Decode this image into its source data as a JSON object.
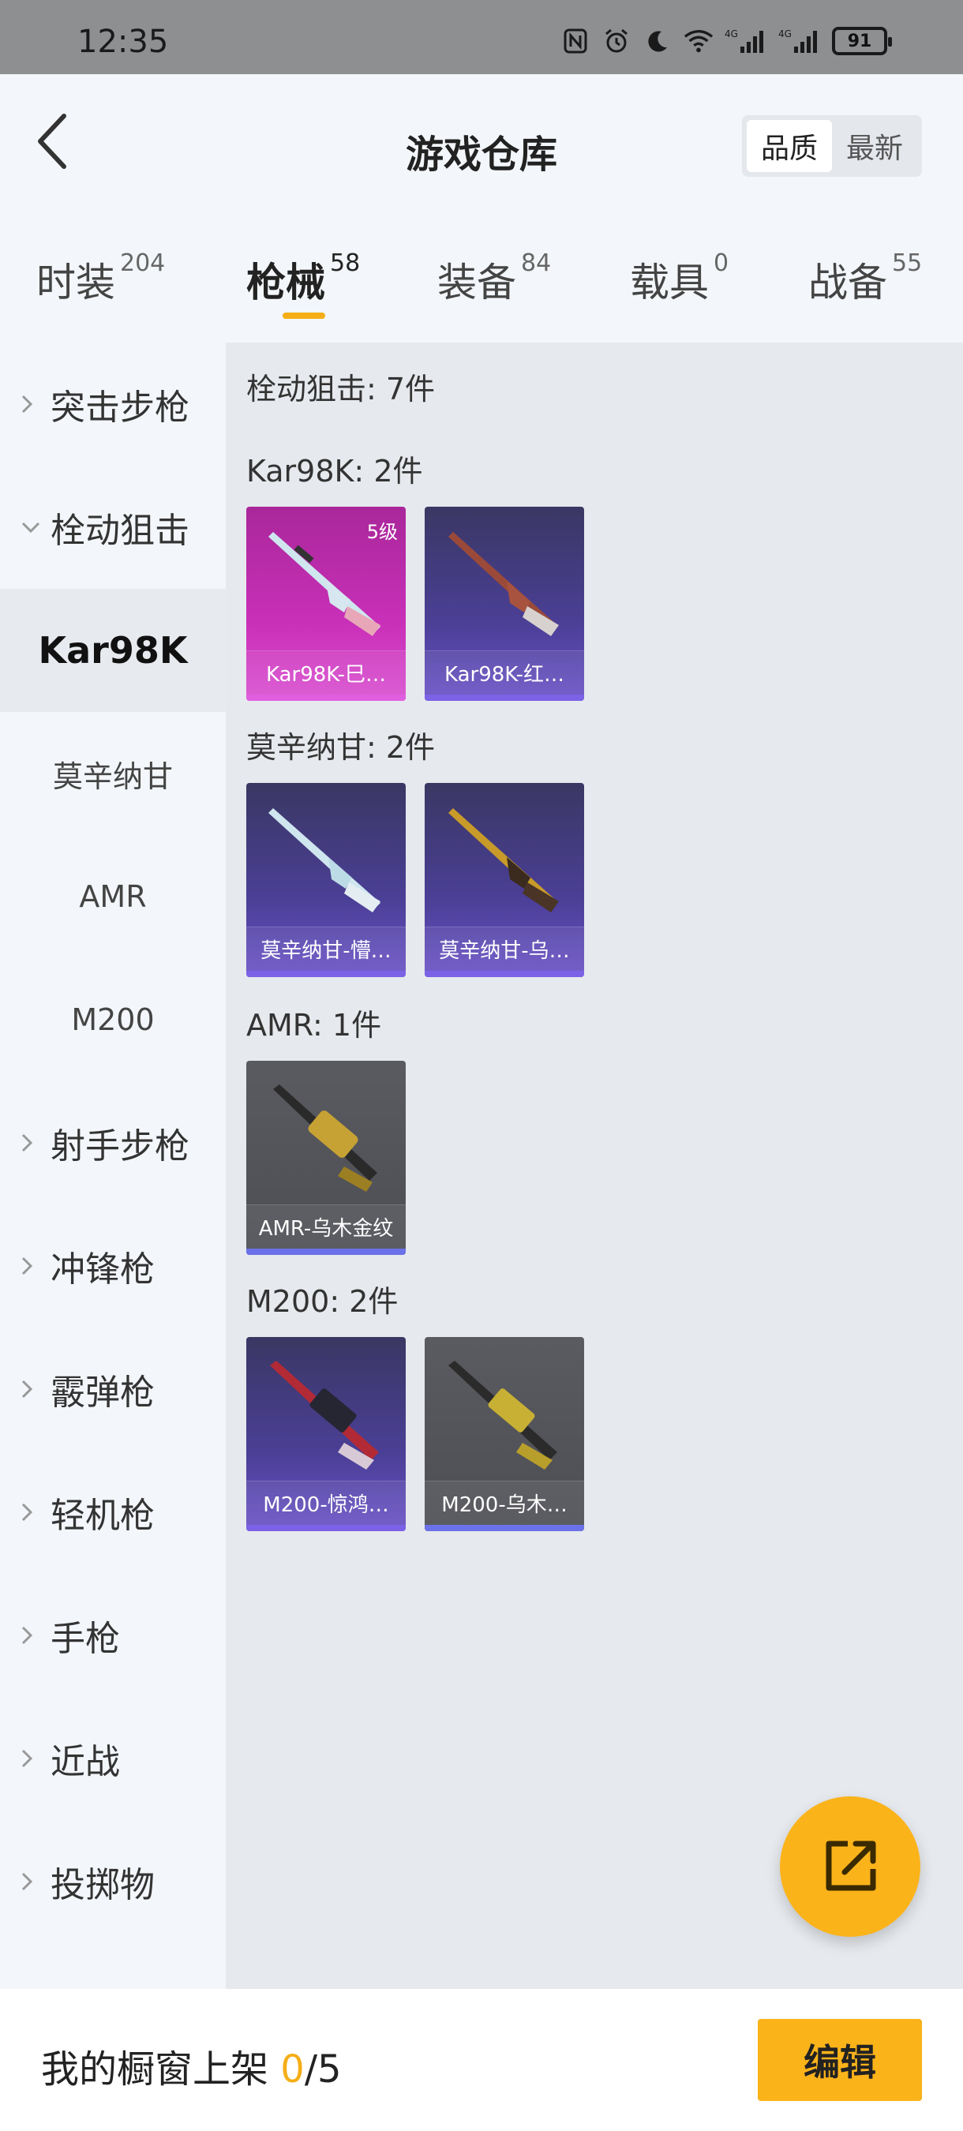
{
  "status_bar": {
    "time": "12:35",
    "battery": "91",
    "net1": "4G",
    "net2": "4G"
  },
  "header": {
    "title": "游戏仓库",
    "sort_options": [
      "品质",
      "最新"
    ],
    "sort_active": "品质"
  },
  "tabs": [
    {
      "label": "时装",
      "count": "204"
    },
    {
      "label": "枪械",
      "count": "58"
    },
    {
      "label": "装备",
      "count": "84"
    },
    {
      "label": "载具",
      "count": "0"
    },
    {
      "label": "战备",
      "count": "55"
    }
  ],
  "sidebar": {
    "items": [
      {
        "label": "突击步枪",
        "expanded": false
      },
      {
        "label": "栓动狙击",
        "expanded": true
      },
      {
        "label": "射手步枪",
        "expanded": false
      },
      {
        "label": "冲锋枪",
        "expanded": false
      },
      {
        "label": "霰弹枪",
        "expanded": false
      },
      {
        "label": "轻机枪",
        "expanded": false
      },
      {
        "label": "手枪",
        "expanded": false
      },
      {
        "label": "近战",
        "expanded": false
      },
      {
        "label": "投掷物",
        "expanded": false
      }
    ],
    "sub_items": [
      "Kar98K",
      "莫辛纳甘",
      "AMR",
      "M200"
    ],
    "active_sub": "Kar98K"
  },
  "content": {
    "summary": "栓动狙击: 7件",
    "groups": [
      {
        "title": "Kar98K: 2件",
        "cards": [
          {
            "name": "Kar98K-巳…",
            "level": "5级",
            "style": "pink"
          },
          {
            "name": "Kar98K-红…",
            "style": "purple"
          }
        ]
      },
      {
        "title": "莫辛纳甘: 2件",
        "cards": [
          {
            "name": "莫辛纳甘-懵…",
            "style": "purple"
          },
          {
            "name": "莫辛纳甘-乌…",
            "style": "purple"
          }
        ]
      },
      {
        "title": "AMR: 1件",
        "cards": [
          {
            "name": "AMR-乌木金纹",
            "style": "gray"
          }
        ]
      },
      {
        "title": "M200: 2件",
        "cards": [
          {
            "name": "M200-惊鸿…",
            "style": "purple"
          },
          {
            "name": "M200-乌木…",
            "style": "gray"
          }
        ]
      }
    ]
  },
  "bottom": {
    "label": "我的橱窗上架 ",
    "current": "0",
    "total": "/5",
    "edit_label": "编辑"
  },
  "icons": {
    "back": "back-arrow-icon",
    "fab": "share-external-icon",
    "chevron": "chevron-right-icon"
  },
  "colors": {
    "accent": "#fbb31a",
    "purple_card": "#4b3f96",
    "pink_card": "#c930b8",
    "gray_card": "#4d4e54"
  }
}
